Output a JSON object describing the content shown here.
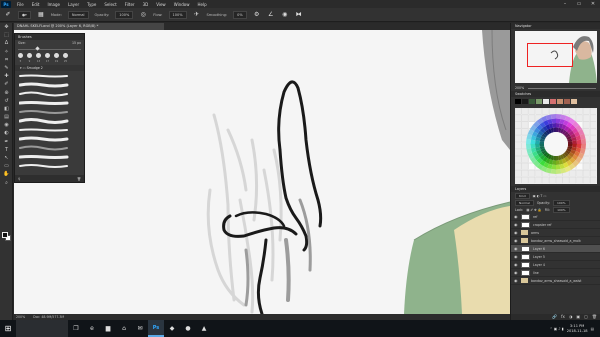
{
  "app": {
    "logo": "Ps"
  },
  "menu": [
    "File",
    "Edit",
    "Image",
    "Layer",
    "Type",
    "Select",
    "Filter",
    "3D",
    "View",
    "Window",
    "Help"
  ],
  "window_controls": [
    "–",
    "▭",
    "✕"
  ],
  "options": {
    "mode_label": "Mode:",
    "mode_value": "Normal",
    "opacity_label": "Opacity:",
    "opacity_value": "100%",
    "flow_label": "Flow:",
    "flow_value": "100%",
    "smoothing_label": "Smoothing:",
    "smoothing_value": "0%"
  },
  "document": {
    "tab_title": "DNAHL SKELFLand @ 200% (Layer 6, RGB/8) *"
  },
  "toolbar": {
    "tools": [
      "move-icon",
      "marquee-icon",
      "lasso-icon",
      "quick-select-icon",
      "crop-icon",
      "eyedropper-icon",
      "healing-icon",
      "brush-icon",
      "clone-stamp-icon",
      "history-brush-icon",
      "eraser-icon",
      "gradient-icon",
      "blur-icon",
      "dodge-icon",
      "pen-icon",
      "type-icon",
      "path-select-icon",
      "rectangle-icon",
      "hand-icon",
      "zoom-icon"
    ],
    "tool_glyphs": [
      "✥",
      "⬚",
      "ᐃ",
      "✧",
      "⌗",
      "✎",
      "✚",
      "✐",
      "⊕",
      "↺",
      "◧",
      "▤",
      "◉",
      "◐",
      "✒",
      "T",
      "↖",
      "▭",
      "✋",
      "⌕"
    ]
  },
  "brushes_panel": {
    "title": "Brushes",
    "size_label": "Size:",
    "size_value": "15 px",
    "tip_numbers": [
      "5",
      "9",
      "13",
      "17",
      "19",
      "25"
    ],
    "group_label": "Smudge 2",
    "footer_left": "⚲",
    "footer_right": "🗑"
  },
  "status": {
    "zoom": "200%",
    "doc_info": "Doc: 48.9M/577.3M"
  },
  "navigator": {
    "title": "Navigator",
    "zoom": "200%"
  },
  "swatches": {
    "title": "Swatches",
    "recent_colors": [
      "#000000",
      "#1a1a1a",
      "#3a5a3a",
      "#7a9a6a",
      "#e8e8e8",
      "#d47070",
      "#c89070",
      "#a06050",
      "#e0c0a0"
    ]
  },
  "layers": {
    "title": "Layers",
    "kind_label": "Kind",
    "blend_mode": "Normal",
    "opacity_label": "Opacity:",
    "opacity_value": "100%",
    "lock_label": "Lock:",
    "fill_label": "Fill:",
    "fill_value": "100%",
    "rows": [
      {
        "name": "ref",
        "kind": "layer"
      },
      {
        "name": "cropster ref",
        "kind": "layer"
      },
      {
        "name": "arms",
        "kind": "folder"
      },
      {
        "name": "bandaz_arms_sheasaid_a_molk",
        "kind": "folder"
      },
      {
        "name": "Layer 6",
        "kind": "layer",
        "selected": true
      },
      {
        "name": "Layer 5",
        "kind": "layer"
      },
      {
        "name": "Layer 4",
        "kind": "layer"
      },
      {
        "name": "line",
        "kind": "layer"
      },
      {
        "name": "bandaz_arms_sheasaid_a_waist",
        "kind": "folder"
      }
    ],
    "footer_icons": [
      "🔗",
      "fx",
      "◑",
      "▣",
      "▢",
      "🗑"
    ]
  },
  "taskbar": {
    "start_glyph": "⊞",
    "search_placeholder": "",
    "apps": [
      {
        "name": "task-view-icon",
        "glyph": "❐"
      },
      {
        "name": "edge-icon",
        "glyph": "e"
      },
      {
        "name": "explorer-icon",
        "glyph": "▆"
      },
      {
        "name": "store-icon",
        "glyph": "⌂"
      },
      {
        "name": "mail-icon",
        "glyph": "✉"
      },
      {
        "name": "photoshop-icon",
        "glyph": "Ps"
      },
      {
        "name": "app-icon-7",
        "glyph": "◆"
      },
      {
        "name": "app-icon-8",
        "glyph": "●"
      },
      {
        "name": "app-icon-9",
        "glyph": "▲"
      }
    ],
    "time": "3:11 PM",
    "date": "2018-11-18"
  }
}
